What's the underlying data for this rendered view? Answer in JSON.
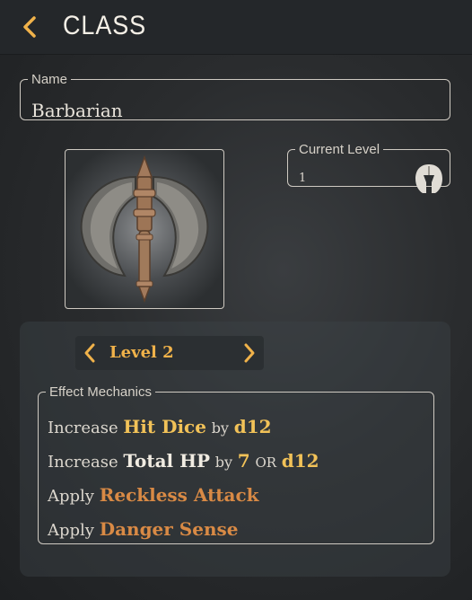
{
  "header": {
    "title": "CLASS"
  },
  "name_field": {
    "legend": "Name",
    "value": "Barbarian"
  },
  "level_field": {
    "legend": "Current Level",
    "value": "1"
  },
  "portrait": {
    "icon": "battle-axe-icon"
  },
  "level_selector": {
    "label": "Level 2"
  },
  "mechanics": {
    "legend": "Effect Mechanics",
    "rows": [
      {
        "verb": "Increase",
        "target": "Hit Dice",
        "by": "by",
        "value": "d12"
      },
      {
        "verb": "Increase",
        "target": "Total HP",
        "by": "by",
        "value": "7",
        "or": "OR",
        "alt": "d12"
      },
      {
        "verb": "Apply",
        "ability": "Reckless Attack"
      },
      {
        "verb": "Apply",
        "ability": "Danger Sense"
      }
    ]
  },
  "colors": {
    "accent": "#f0b24a",
    "ability": "#d98a45",
    "background": "#2a2c2e"
  }
}
